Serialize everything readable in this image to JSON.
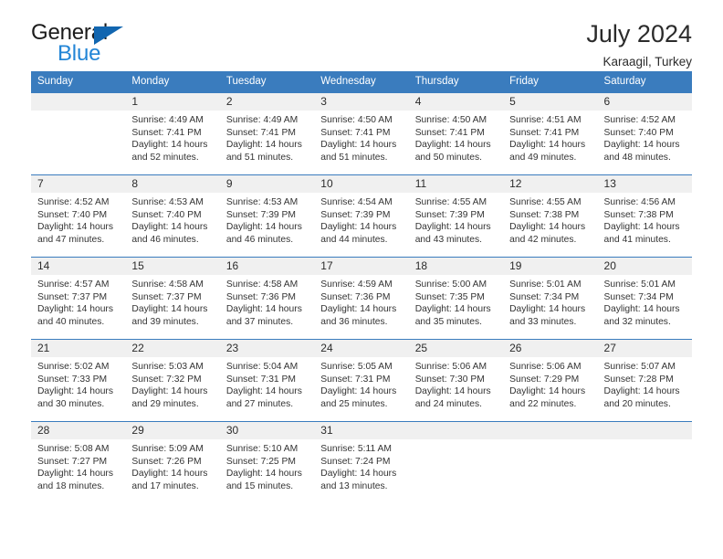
{
  "brand": {
    "name_top": "General",
    "name_bottom": "Blue",
    "triangle_color": "#1266b0",
    "blue_color": "#2285d6"
  },
  "header": {
    "month_title": "July 2024",
    "location": "Karaagil, Turkey"
  },
  "theme": {
    "header_blue": "#3a7cbe",
    "daynum_band": "#f0f0f0",
    "text": "#333333"
  },
  "weekday_headers": [
    "Sunday",
    "Monday",
    "Tuesday",
    "Wednesday",
    "Thursday",
    "Friday",
    "Saturday"
  ],
  "weeks": [
    [
      {
        "day": "",
        "empty": true,
        "sunrise": "",
        "sunset": "",
        "daylight_1": "",
        "daylight_2": ""
      },
      {
        "day": "1",
        "sunrise": "Sunrise: 4:49 AM",
        "sunset": "Sunset: 7:41 PM",
        "daylight_1": "Daylight: 14 hours",
        "daylight_2": "and 52 minutes."
      },
      {
        "day": "2",
        "sunrise": "Sunrise: 4:49 AM",
        "sunset": "Sunset: 7:41 PM",
        "daylight_1": "Daylight: 14 hours",
        "daylight_2": "and 51 minutes."
      },
      {
        "day": "3",
        "sunrise": "Sunrise: 4:50 AM",
        "sunset": "Sunset: 7:41 PM",
        "daylight_1": "Daylight: 14 hours",
        "daylight_2": "and 51 minutes."
      },
      {
        "day": "4",
        "sunrise": "Sunrise: 4:50 AM",
        "sunset": "Sunset: 7:41 PM",
        "daylight_1": "Daylight: 14 hours",
        "daylight_2": "and 50 minutes."
      },
      {
        "day": "5",
        "sunrise": "Sunrise: 4:51 AM",
        "sunset": "Sunset: 7:41 PM",
        "daylight_1": "Daylight: 14 hours",
        "daylight_2": "and 49 minutes."
      },
      {
        "day": "6",
        "sunrise": "Sunrise: 4:52 AM",
        "sunset": "Sunset: 7:40 PM",
        "daylight_1": "Daylight: 14 hours",
        "daylight_2": "and 48 minutes."
      }
    ],
    [
      {
        "day": "7",
        "sunrise": "Sunrise: 4:52 AM",
        "sunset": "Sunset: 7:40 PM",
        "daylight_1": "Daylight: 14 hours",
        "daylight_2": "and 47 minutes."
      },
      {
        "day": "8",
        "sunrise": "Sunrise: 4:53 AM",
        "sunset": "Sunset: 7:40 PM",
        "daylight_1": "Daylight: 14 hours",
        "daylight_2": "and 46 minutes."
      },
      {
        "day": "9",
        "sunrise": "Sunrise: 4:53 AM",
        "sunset": "Sunset: 7:39 PM",
        "daylight_1": "Daylight: 14 hours",
        "daylight_2": "and 46 minutes."
      },
      {
        "day": "10",
        "sunrise": "Sunrise: 4:54 AM",
        "sunset": "Sunset: 7:39 PM",
        "daylight_1": "Daylight: 14 hours",
        "daylight_2": "and 44 minutes."
      },
      {
        "day": "11",
        "sunrise": "Sunrise: 4:55 AM",
        "sunset": "Sunset: 7:39 PM",
        "daylight_1": "Daylight: 14 hours",
        "daylight_2": "and 43 minutes."
      },
      {
        "day": "12",
        "sunrise": "Sunrise: 4:55 AM",
        "sunset": "Sunset: 7:38 PM",
        "daylight_1": "Daylight: 14 hours",
        "daylight_2": "and 42 minutes."
      },
      {
        "day": "13",
        "sunrise": "Sunrise: 4:56 AM",
        "sunset": "Sunset: 7:38 PM",
        "daylight_1": "Daylight: 14 hours",
        "daylight_2": "and 41 minutes."
      }
    ],
    [
      {
        "day": "14",
        "sunrise": "Sunrise: 4:57 AM",
        "sunset": "Sunset: 7:37 PM",
        "daylight_1": "Daylight: 14 hours",
        "daylight_2": "and 40 minutes."
      },
      {
        "day": "15",
        "sunrise": "Sunrise: 4:58 AM",
        "sunset": "Sunset: 7:37 PM",
        "daylight_1": "Daylight: 14 hours",
        "daylight_2": "and 39 minutes."
      },
      {
        "day": "16",
        "sunrise": "Sunrise: 4:58 AM",
        "sunset": "Sunset: 7:36 PM",
        "daylight_1": "Daylight: 14 hours",
        "daylight_2": "and 37 minutes."
      },
      {
        "day": "17",
        "sunrise": "Sunrise: 4:59 AM",
        "sunset": "Sunset: 7:36 PM",
        "daylight_1": "Daylight: 14 hours",
        "daylight_2": "and 36 minutes."
      },
      {
        "day": "18",
        "sunrise": "Sunrise: 5:00 AM",
        "sunset": "Sunset: 7:35 PM",
        "daylight_1": "Daylight: 14 hours",
        "daylight_2": "and 35 minutes."
      },
      {
        "day": "19",
        "sunrise": "Sunrise: 5:01 AM",
        "sunset": "Sunset: 7:34 PM",
        "daylight_1": "Daylight: 14 hours",
        "daylight_2": "and 33 minutes."
      },
      {
        "day": "20",
        "sunrise": "Sunrise: 5:01 AM",
        "sunset": "Sunset: 7:34 PM",
        "daylight_1": "Daylight: 14 hours",
        "daylight_2": "and 32 minutes."
      }
    ],
    [
      {
        "day": "21",
        "sunrise": "Sunrise: 5:02 AM",
        "sunset": "Sunset: 7:33 PM",
        "daylight_1": "Daylight: 14 hours",
        "daylight_2": "and 30 minutes."
      },
      {
        "day": "22",
        "sunrise": "Sunrise: 5:03 AM",
        "sunset": "Sunset: 7:32 PM",
        "daylight_1": "Daylight: 14 hours",
        "daylight_2": "and 29 minutes."
      },
      {
        "day": "23",
        "sunrise": "Sunrise: 5:04 AM",
        "sunset": "Sunset: 7:31 PM",
        "daylight_1": "Daylight: 14 hours",
        "daylight_2": "and 27 minutes."
      },
      {
        "day": "24",
        "sunrise": "Sunrise: 5:05 AM",
        "sunset": "Sunset: 7:31 PM",
        "daylight_1": "Daylight: 14 hours",
        "daylight_2": "and 25 minutes."
      },
      {
        "day": "25",
        "sunrise": "Sunrise: 5:06 AM",
        "sunset": "Sunset: 7:30 PM",
        "daylight_1": "Daylight: 14 hours",
        "daylight_2": "and 24 minutes."
      },
      {
        "day": "26",
        "sunrise": "Sunrise: 5:06 AM",
        "sunset": "Sunset: 7:29 PM",
        "daylight_1": "Daylight: 14 hours",
        "daylight_2": "and 22 minutes."
      },
      {
        "day": "27",
        "sunrise": "Sunrise: 5:07 AM",
        "sunset": "Sunset: 7:28 PM",
        "daylight_1": "Daylight: 14 hours",
        "daylight_2": "and 20 minutes."
      }
    ],
    [
      {
        "day": "28",
        "sunrise": "Sunrise: 5:08 AM",
        "sunset": "Sunset: 7:27 PM",
        "daylight_1": "Daylight: 14 hours",
        "daylight_2": "and 18 minutes."
      },
      {
        "day": "29",
        "sunrise": "Sunrise: 5:09 AM",
        "sunset": "Sunset: 7:26 PM",
        "daylight_1": "Daylight: 14 hours",
        "daylight_2": "and 17 minutes."
      },
      {
        "day": "30",
        "sunrise": "Sunrise: 5:10 AM",
        "sunset": "Sunset: 7:25 PM",
        "daylight_1": "Daylight: 14 hours",
        "daylight_2": "and 15 minutes."
      },
      {
        "day": "31",
        "sunrise": "Sunrise: 5:11 AM",
        "sunset": "Sunset: 7:24 PM",
        "daylight_1": "Daylight: 14 hours",
        "daylight_2": "and 13 minutes."
      },
      {
        "day": "",
        "empty": true,
        "sunrise": "",
        "sunset": "",
        "daylight_1": "",
        "daylight_2": ""
      },
      {
        "day": "",
        "empty": true,
        "sunrise": "",
        "sunset": "",
        "daylight_1": "",
        "daylight_2": ""
      },
      {
        "day": "",
        "empty": true,
        "sunrise": "",
        "sunset": "",
        "daylight_1": "",
        "daylight_2": ""
      }
    ]
  ]
}
